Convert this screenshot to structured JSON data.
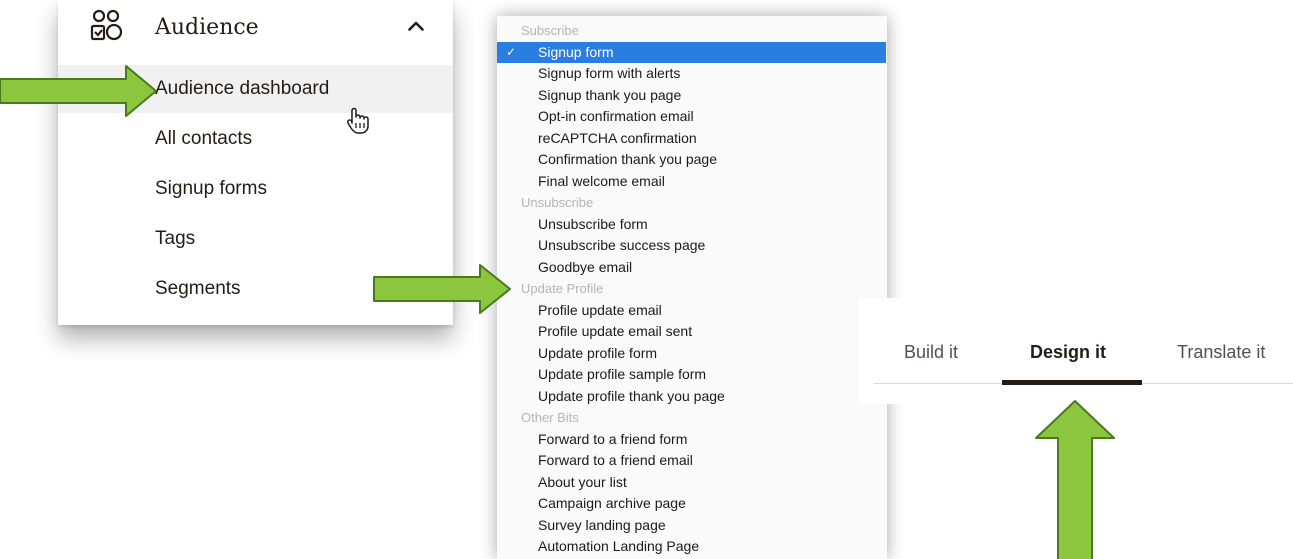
{
  "audience_menu": {
    "title": "Audience",
    "items": [
      {
        "label": "Audience dashboard"
      },
      {
        "label": "All contacts"
      },
      {
        "label": "Signup forms"
      },
      {
        "label": "Tags"
      },
      {
        "label": "Segments"
      }
    ]
  },
  "form_dropdown": {
    "groups": {
      "subscribe": "Subscribe",
      "unsubscribe": "Unsubscribe",
      "update_profile": "Update Profile",
      "other_bits": "Other Bits"
    },
    "options": [
      "Signup form",
      "Signup form with alerts",
      "Signup thank you page",
      "Opt-in confirmation email",
      "reCAPTCHA confirmation",
      "Confirmation thank you page",
      "Final welcome email",
      "Unsubscribe form",
      "Unsubscribe success page",
      "Goodbye email",
      "Profile update email",
      "Profile update email sent",
      "Update profile form",
      "Update profile sample form",
      "Update profile thank you page",
      "Forward to a friend form",
      "Forward to a friend email",
      "About your list",
      "Campaign archive page",
      "Survey landing page",
      "Automation Landing Page"
    ],
    "selected": "Signup form",
    "check_glyph": "✓"
  },
  "tabs": {
    "build": "Build it",
    "design": "Design it",
    "translate": "Translate it",
    "active": "Design it"
  },
  "colors": {
    "arrow_fill": "#8cc63f",
    "arrow_stroke": "#4a7a1f",
    "selection": "#2a7de1",
    "text": "#241c15"
  }
}
